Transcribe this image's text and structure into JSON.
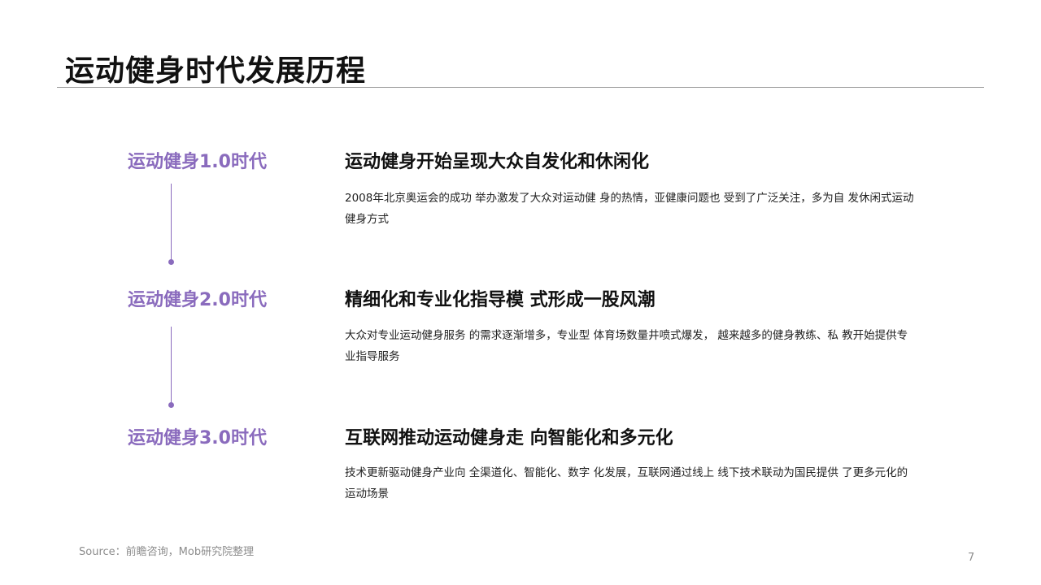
{
  "title": "运动健身时代发展历程",
  "eras": [
    {
      "label": "运动健身1.0时代",
      "heading": "运动健身开始呈现大众自发化和休闲化",
      "description": "2008年北京奥运会的成功 举办激发了大众对运动健 身的热情，亚健康问题也 受到了广泛关注，多为自 发休闲式运动健身方式"
    },
    {
      "label": "运动健身2.0时代",
      "heading": "精细化和专业化指导模 式形成一股风潮",
      "description": "大众对专业运动健身服务 的需求逐渐增多，专业型 体育场数量井喷式爆发， 越来越多的健身教练、私 教开始提供专业指导服务"
    },
    {
      "label": "运动健身3.0时代",
      "heading": "互联网推动运动健身走 向智能化和多元化",
      "description": "技术更新驱动健身产业向 全渠道化、智能化、数字 化发展，互联网通过线上 线下技术联动为国民提供 了更多元化的运动场景"
    }
  ],
  "source": "Source：前瞻咨询，Mob研究院整理",
  "page_number": "7",
  "colors": {
    "accent": "#8a6bbd",
    "rule": "#9a9a9a",
    "muted": "#8c8c8c"
  }
}
